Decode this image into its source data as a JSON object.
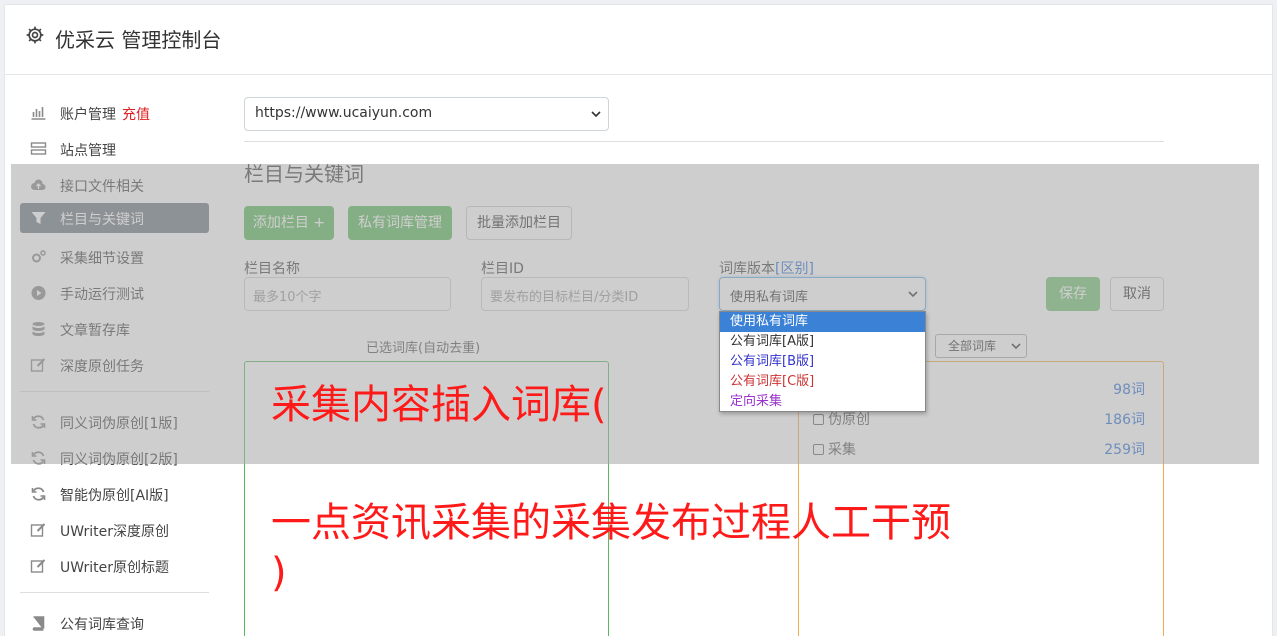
{
  "header": {
    "title": "优采云 管理控制台",
    "icon": "gear-icon"
  },
  "sidebar": {
    "items": [
      {
        "label": "账户管理",
        "extra": "充值",
        "icon": "bar-chart-icon"
      },
      {
        "label": "站点管理",
        "icon": "server-icon"
      },
      {
        "label": "接口文件相关",
        "icon": "cloud-upload-icon"
      },
      {
        "label": "栏目与关键词",
        "icon": "filter-icon",
        "active": true
      },
      {
        "label": "采集细节设置",
        "icon": "cogs-icon"
      },
      {
        "label": "手动运行测试",
        "icon": "play-circle-icon"
      },
      {
        "label": "文章暂存库",
        "icon": "database-icon"
      },
      {
        "label": "深度原创任务",
        "icon": "edit-icon"
      },
      {
        "label": "同义词伪原创[1版]",
        "icon": "refresh-icon"
      },
      {
        "label": "同义词伪原创[2版]",
        "icon": "refresh-icon"
      },
      {
        "label": "智能伪原创[AI版]",
        "icon": "refresh-icon"
      },
      {
        "label": "UWriter深度原创",
        "icon": "edit-icon"
      },
      {
        "label": "UWriter原创标题",
        "icon": "edit-icon"
      },
      {
        "label": "公有词库查询",
        "icon": "book-icon"
      }
    ]
  },
  "main": {
    "site_select": "https://www.ucaiyun.com",
    "section_title": "栏目与关键词",
    "buttons": {
      "add_column": "添加栏目 +",
      "private_lib": "私有词库管理",
      "batch_add": "批量添加栏目",
      "save": "保存",
      "cancel": "取消"
    },
    "form": {
      "name_label": "栏目名称",
      "name_placeholder": "最多10个字",
      "id_label": "栏目ID",
      "id_placeholder": "要发布的目标栏目/分类ID",
      "version_label": "词库版本",
      "version_link": "[区别]",
      "version_value": "使用私有词库",
      "version_options": [
        {
          "label": "使用私有词库",
          "color": "#ffffff",
          "selected": true
        },
        {
          "label": "公有词库[A版]",
          "color": "#333333"
        },
        {
          "label": "公有词库[B版]",
          "color": "#3333cc"
        },
        {
          "label": "公有词库[C版]",
          "color": "#cc3333"
        },
        {
          "label": "定向采集",
          "color": "#9933cc"
        }
      ]
    },
    "selected_title": "已选词库(自动去重)",
    "filter_value": "全部词库",
    "libraries": [
      {
        "name": "",
        "count": "98词"
      },
      {
        "name": "伪原创",
        "count": "186词"
      },
      {
        "name": "采集",
        "count": "259词"
      }
    ]
  },
  "overlay_text": {
    "line1": "采集内容插入词库(",
    "line2": "一点资讯采集的采集发布过程人工干预",
    "line3": ")"
  }
}
